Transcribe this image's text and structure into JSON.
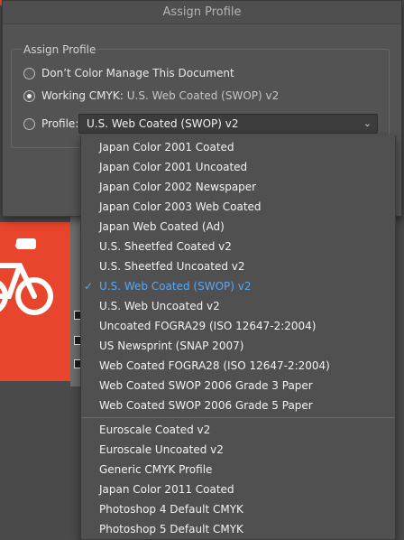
{
  "dialog": {
    "title": "Assign Profile",
    "group_label": "Assign Profile",
    "options": [
      {
        "label": "Don’t Color Manage This Document",
        "sub": "",
        "checked": false
      },
      {
        "label": "Working CMYK:",
        "sub": "U.S. Web Coated (SWOP) v2",
        "checked": true
      },
      {
        "label": "Profile:",
        "sub": "",
        "checked": false
      }
    ],
    "profile_select": {
      "value": "U.S. Web Coated (SWOP) v2"
    }
  },
  "menu": {
    "group1": [
      "Japan Color 2001 Coated",
      "Japan Color 2001 Uncoated",
      "Japan Color 2002 Newspaper",
      "Japan Color 2003 Web Coated",
      "Japan Web Coated (Ad)",
      "U.S. Sheetfed Coated v2",
      "U.S. Sheetfed Uncoated v2",
      "U.S. Web Coated (SWOP) v2",
      "U.S. Web Uncoated v2",
      "Uncoated FOGRA29 (ISO 12647-2:2004)",
      "US Newsprint (SNAP 2007)",
      "Web Coated FOGRA28 (ISO 12647-2:2004)",
      "Web Coated SWOP 2006 Grade 3 Paper",
      "Web Coated SWOP 2006 Grade 5 Paper"
    ],
    "group2": [
      "Euroscale Coated v2",
      "Euroscale Uncoated v2",
      "Generic CMYK Profile",
      "Japan Color 2011 Coated",
      "Photoshop 4 Default CMYK",
      "Photoshop 5 Default CMYK"
    ],
    "selected": "U.S. Web Coated (SWOP) v2",
    "check_glyph": "✓"
  },
  "colors": {
    "accent": "#5aa7f2",
    "art_red": "#e8462c"
  }
}
